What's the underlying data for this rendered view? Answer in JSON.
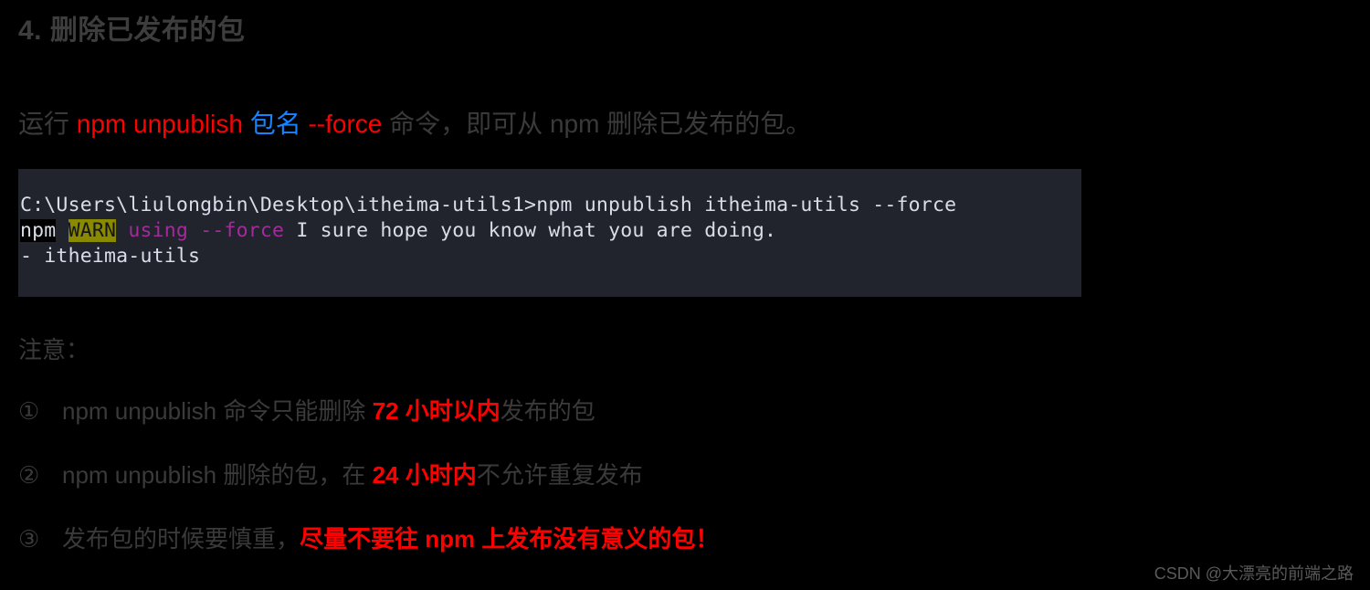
{
  "page": {
    "background_color": "#000000",
    "body_text_color": "#3a3a3a",
    "accent_red": "#ff0000",
    "accent_blue": "#1683ff"
  },
  "heading": {
    "text": "4. 删除已发布的包"
  },
  "intro": {
    "prefix": "运行 ",
    "command": "npm unpublish",
    "space1": " ",
    "package_placeholder": "包名",
    "space2": " ",
    "flag": "--force",
    "suffix": " 命令，即可从 npm 删除已发布的包。"
  },
  "terminal": {
    "background_color": "#21242d",
    "text_color": "#d8dde8",
    "warn_background_color": "#8a8a00",
    "magenta_color": "#a52a9b",
    "line1": "C:\\Users\\liulongbin\\Desktop\\itheima-utils1>npm unpublish itheima-utils --force",
    "line2": {
      "npm_tag": "npm",
      "gap1": " ",
      "warn_tag": "WARN",
      "gap2": " ",
      "magenta_text": "using --force",
      "rest": " I sure hope you know what you are doing."
    },
    "line3": "- itheima-utils"
  },
  "note": {
    "label": "注意：",
    "items": [
      {
        "marker": "①",
        "before": "npm unpublish 命令只能删除 ",
        "highlight": "72 小时以内",
        "after": "发布的包"
      },
      {
        "marker": "②",
        "before": "npm unpublish 删除的包，在 ",
        "highlight": "24 小时内",
        "after": "不允许重复发布"
      },
      {
        "marker": "③",
        "before": "发布包的时候要慎重，",
        "highlight": "尽量不要往 npm 上发布没有意义的包！",
        "after": ""
      }
    ]
  },
  "watermark": {
    "text": "CSDN @大漂亮的前端之路"
  }
}
